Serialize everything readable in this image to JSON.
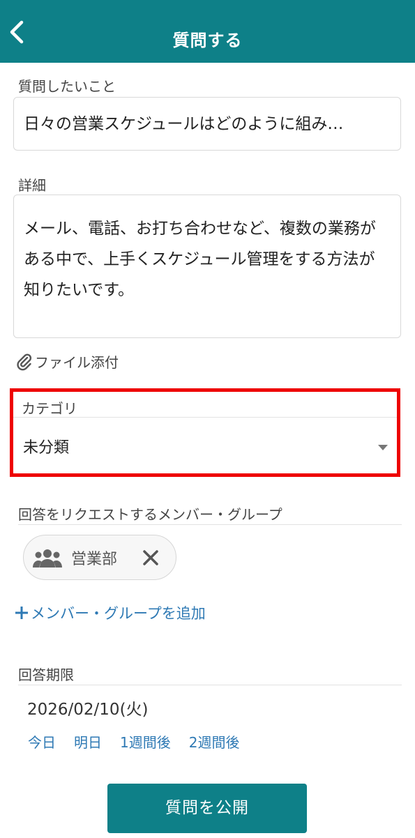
{
  "header": {
    "title": "質問する",
    "back_icon": "chevron-left-icon"
  },
  "question": {
    "label": "質問したいこと",
    "value": "日々の営業スケジュールはどのように組み…"
  },
  "details": {
    "label": "詳細",
    "value": "メール、電話、お打ち合わせなど、複数の業務がある中で、上手くスケジュール管理をする方法が知りたいです。"
  },
  "attachment": {
    "label": "ファイル添付",
    "icon": "paperclip-icon"
  },
  "category": {
    "label": "カテゴリ",
    "selected": "未分類",
    "icon": "caret-down-icon"
  },
  "request_members": {
    "label": "回答をリクエストするメンバー・グループ",
    "chips": [
      {
        "name": "営業部",
        "icon": "group-icon",
        "remove_icon": "close-icon"
      }
    ],
    "add_label": "メンバー・グループを追加",
    "add_icon": "plus-icon"
  },
  "deadline": {
    "label": "回答期限",
    "value": "2026/02/10(火)",
    "shortcuts": [
      "今日",
      "明日",
      "1週間後",
      "2週間後"
    ]
  },
  "submit": {
    "label": "質問を公開"
  },
  "colors": {
    "brand": "#0e8088",
    "link": "#2e79b4",
    "highlight": "#ee0000"
  }
}
